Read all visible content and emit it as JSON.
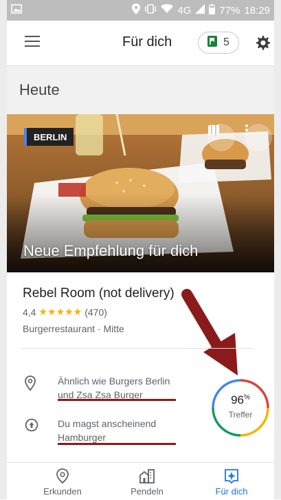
{
  "status_bar": {
    "network": "4G",
    "battery": "77%",
    "time": "18:29"
  },
  "header": {
    "title": "Für dich",
    "saved_count": "5"
  },
  "section": {
    "title": "Heute"
  },
  "hero": {
    "city_chip": "BERLIN",
    "title": "Neue Empfehlung für dich"
  },
  "place": {
    "name": "Rebel Room (not delivery)",
    "rating": "4,4",
    "stars": "★★★★★",
    "reviews": "(470)",
    "category": "Burgerrestaurant · Mitte"
  },
  "reasons": [
    {
      "icon": "location-pin-icon",
      "text": "Ähnlich wie Burgers Berlin und Zsa Zsa Burger"
    },
    {
      "icon": "thumbs-up-circle-icon",
      "text": "Du magst anscheinend Hamburger"
    }
  ],
  "match": {
    "percent": "96",
    "percent_sign": "%",
    "label": "Treffer"
  },
  "nav": [
    {
      "label": "Erkunden",
      "icon": "explore-pin-icon"
    },
    {
      "label": "Pendeln",
      "icon": "commute-buildings-icon"
    },
    {
      "label": "Für dich",
      "icon": "for-you-sparkle-icon",
      "active": true
    }
  ],
  "colors": {
    "accent_blue": "#1a73e8",
    "star_yellow": "#f4b400",
    "annotation_red": "#8b1a1a",
    "badge_green": "#188038"
  }
}
